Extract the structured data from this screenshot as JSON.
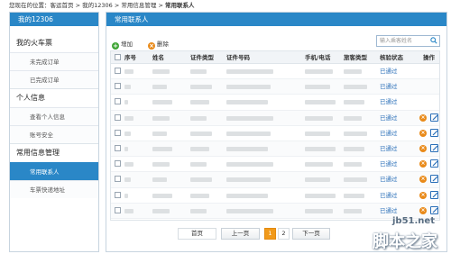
{
  "breadcrumb": {
    "prefix": "您现在的位置：",
    "items": [
      "客运首页",
      "我的12306",
      "常用信息管理"
    ],
    "current": "常用联系人",
    "sep": " > "
  },
  "sidebar": {
    "title": "我的12306",
    "groups": [
      {
        "label": "我的火车票",
        "items": [
          {
            "label": "未完成订单",
            "active": false
          },
          {
            "label": "已完成订单",
            "active": false
          }
        ]
      },
      {
        "label": "个人信息",
        "items": [
          {
            "label": "查看个人信息",
            "active": false
          },
          {
            "label": "账号安全",
            "active": false
          }
        ]
      },
      {
        "label": "常用信息管理",
        "items": [
          {
            "label": "常用联系人",
            "active": true
          },
          {
            "label": "车票快递地址",
            "active": false
          }
        ]
      }
    ]
  },
  "main": {
    "title": "常用联系人",
    "add_label": "增加",
    "delete_label": "删除",
    "search_placeholder": "输入乘客姓名",
    "columns": [
      "序号",
      "姓名",
      "证件类型",
      "证件号码",
      "手机/电话",
      "旅客类型",
      "核验状态",
      "操作"
    ],
    "rows": [
      {
        "status": "已通过",
        "actions": false
      },
      {
        "status": "已通过",
        "actions": false
      },
      {
        "status": "已通过",
        "actions": false
      },
      {
        "status": "已通过",
        "actions": true
      },
      {
        "status": "已通过",
        "actions": true
      },
      {
        "status": "已通过",
        "actions": true
      },
      {
        "status": "已通过",
        "actions": true
      },
      {
        "status": "已通过",
        "actions": true
      },
      {
        "status": "已通过",
        "actions": true
      },
      {
        "status": "已通过",
        "actions": true
      }
    ]
  },
  "pager": {
    "first": "首页",
    "prev": "上一页",
    "pages": [
      "1",
      "2"
    ],
    "current_page": "1",
    "next": "下一页"
  },
  "watermark": {
    "site": "jb51.net",
    "name": "脚本之家"
  },
  "colors": {
    "header_blue": "#2a87c7",
    "status_blue": "#2a6fb8",
    "orange": "#e98a19",
    "green": "#3fa535"
  }
}
